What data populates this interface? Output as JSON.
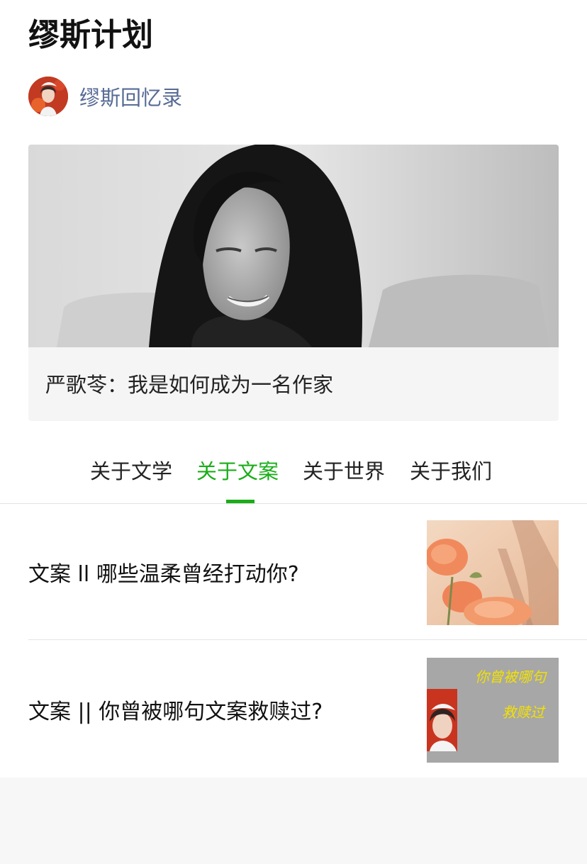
{
  "article": {
    "title": "缪斯计划",
    "author_name": "缪斯回忆录"
  },
  "banner": {
    "caption": "严歌苓：我是如何成为一名作家"
  },
  "tabs": [
    {
      "label": "关于文学"
    },
    {
      "label": "关于文案"
    },
    {
      "label": "关于世界"
    },
    {
      "label": "关于我们"
    }
  ],
  "active_tab": "关于文案",
  "list": [
    {
      "title": "文案 ll 哪些温柔曾经打动你?"
    },
    {
      "title": "文案 || 你曾被哪句文案救赎过?",
      "thumb_text_line1": "你曾被哪句",
      "thumb_text_line2": "救赎过"
    }
  ],
  "colors": {
    "accent": "#1aad19",
    "link": "#576b95",
    "background": "#f7f7f7"
  }
}
